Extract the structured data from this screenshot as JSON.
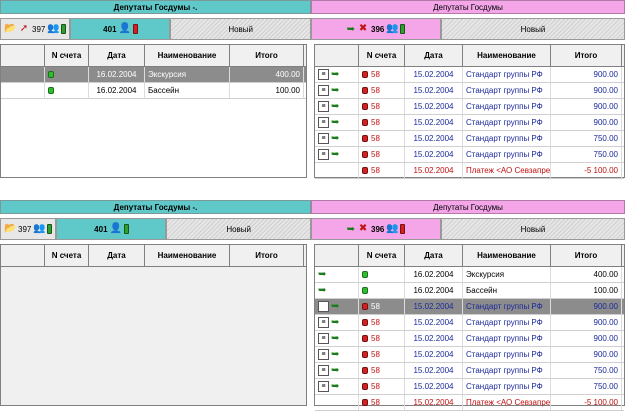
{
  "panels": {
    "left_title": "Депутаты Госдумы -.",
    "right_title": "Депутаты Госдумы"
  },
  "tabs": {
    "left_count": "397",
    "left_active": "401",
    "right_active": "396",
    "new_label": "Новый"
  },
  "columns": {
    "num": "N счета",
    "date": "Дата",
    "name": "Наименование",
    "total": "Итого"
  },
  "shot1": {
    "left_rows": [
      {
        "num": "",
        "date": "16.02.2004",
        "name": "Экскурсия",
        "total": "400.00"
      },
      {
        "num": "",
        "date": "16.02.2004",
        "name": "Бассейн",
        "total": "100.00"
      }
    ],
    "right_rows": [
      {
        "num": "58",
        "date": "15.02.2004",
        "name": "Стандарт группы РФ",
        "total": "900.00"
      },
      {
        "num": "58",
        "date": "15.02.2004",
        "name": "Стандарт группы РФ",
        "total": "900.00"
      },
      {
        "num": "58",
        "date": "15.02.2004",
        "name": "Стандарт группы РФ",
        "total": "900.00"
      },
      {
        "num": "58",
        "date": "15.02.2004",
        "name": "Стандарт группы РФ",
        "total": "900.00"
      },
      {
        "num": "58",
        "date": "15.02.2004",
        "name": "Стандарт группы РФ",
        "total": "750.00"
      },
      {
        "num": "58",
        "date": "15.02.2004",
        "name": "Стандарт группы РФ",
        "total": "750.00"
      },
      {
        "num": "58",
        "date": "15.02.2004",
        "name": "Платеж <АО Севзапре",
        "total": "-5 100.00"
      }
    ]
  },
  "shot2": {
    "right_rows": [
      {
        "num": "",
        "date": "16.02.2004",
        "name": "Экскурсия",
        "total": "400.00"
      },
      {
        "num": "",
        "date": "16.02.2004",
        "name": "Бассейн",
        "total": "100.00"
      },
      {
        "num": "58",
        "date": "15.02.2004",
        "name": "Стандарт группы РФ",
        "total": "900.00"
      },
      {
        "num": "58",
        "date": "15.02.2004",
        "name": "Стандарт группы РФ",
        "total": "900.00"
      },
      {
        "num": "58",
        "date": "15.02.2004",
        "name": "Стандарт группы РФ",
        "total": "900.00"
      },
      {
        "num": "58",
        "date": "15.02.2004",
        "name": "Стандарт группы РФ",
        "total": "900.00"
      },
      {
        "num": "58",
        "date": "15.02.2004",
        "name": "Стандарт группы РФ",
        "total": "750.00"
      },
      {
        "num": "58",
        "date": "15.02.2004",
        "name": "Стандарт группы РФ",
        "total": "750.00"
      },
      {
        "num": "58",
        "date": "15.02.2004",
        "name": "Платеж <АО Севзапре",
        "total": "-5 100.00"
      }
    ]
  }
}
